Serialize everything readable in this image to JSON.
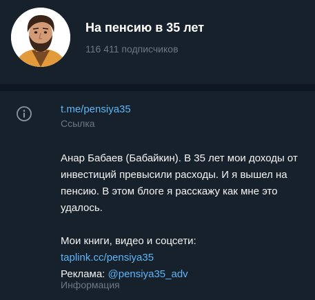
{
  "channel": {
    "name": "На пенсию в 35 лет",
    "subscribers": "116 411 подписчиков"
  },
  "info": {
    "link": "t.me/pensiya35",
    "link_caption": "Ссылка",
    "description": "Анар Бабаев (Бабайкин). В 35 лет мои доходы от инвестиций превысили расходы. И я вышел на пенсию. В этом блоге я расскажу как мне это удалось.",
    "links_heading": "Мои книги, видео и соцсети:",
    "taplink": "taplink.cc/pensiya35",
    "ads_label": "Реклама:",
    "ads_handle": "@pensiya35_adv",
    "info_caption": "Информация"
  },
  "colors": {
    "background": "#17212b",
    "divider": "#0e1621",
    "link": "#5eb5f7",
    "muted": "#6d7883",
    "text": "#f5f5f5"
  },
  "icons": {
    "info": "info-circle-icon"
  }
}
